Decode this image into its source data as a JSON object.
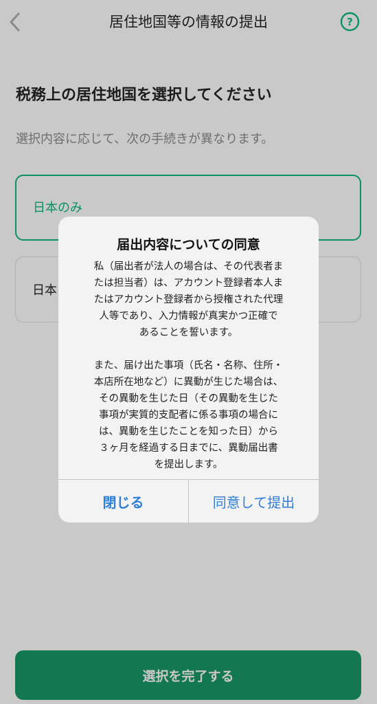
{
  "header": {
    "title": "居住地国等の情報の提出",
    "back_icon": "chevron-left-icon",
    "help_icon": "question-circle-icon",
    "help_label": "?"
  },
  "main": {
    "title": "税務上の居住地国を選択してください",
    "description": "選択内容に応じて、次の手続きが異なります。",
    "options": [
      {
        "label": "日本のみ",
        "selected": true
      },
      {
        "label": "日本",
        "selected": false
      }
    ],
    "complete_button": "選択を完了する"
  },
  "dialog": {
    "title": "届出内容についての同意",
    "paragraph1_lines": [
      "私（届出者が法人の場合は、その代表者ま",
      "たは担当者）は、アカウント登録者本人ま",
      "たはアカウント登録者から授権された代理",
      "人等であり、入力情報が真実かつ正確で",
      "あることを誓います。"
    ],
    "paragraph2_lines": [
      "また、届け出た事項（氏名・名称、住所・",
      "本店所在地など）に異動が生じた場合は、",
      "その異動を生じた日（その異動を生じた",
      "事項が実質的支配者に係る事項の場合に",
      "は、異動を生じたことを知った日）から",
      "３ヶ月を経過する日までに、異動届出書",
      "を提出します。"
    ],
    "close_button": "閉じる",
    "agree_button": "同意して提出"
  },
  "colors": {
    "accent_green": "#0b9162",
    "button_green": "#137852",
    "link_blue": "#2f7ed8",
    "overlay_gray": "#c9c9c9"
  }
}
